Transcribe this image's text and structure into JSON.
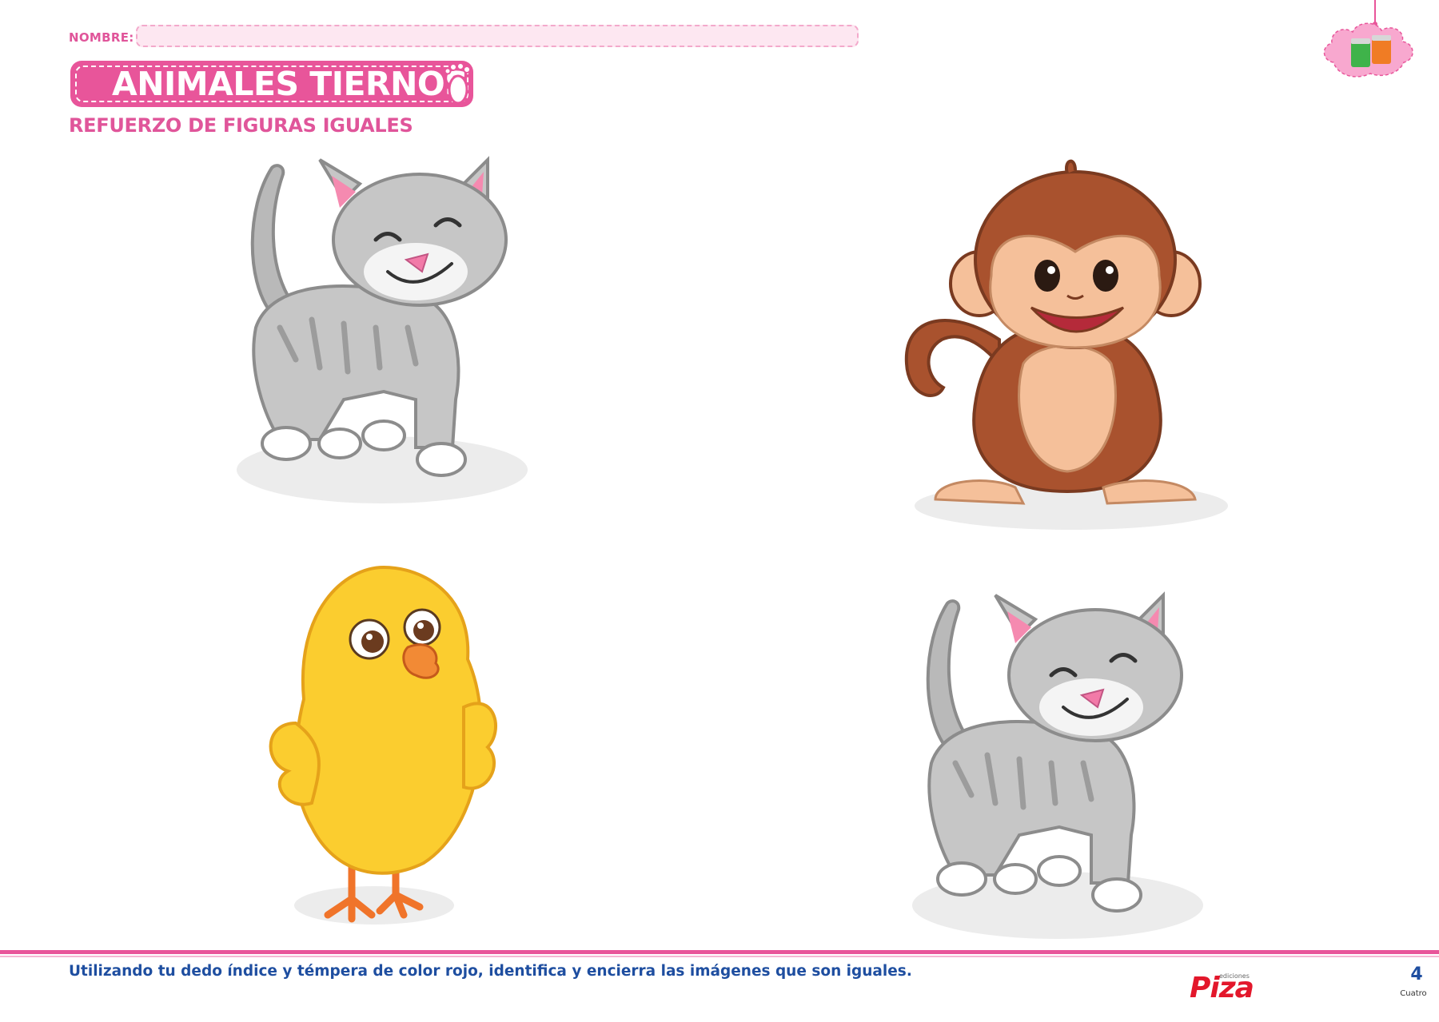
{
  "header": {
    "name_label": "NOMBRE:",
    "title": "ANIMALES TIERNOS",
    "subtitle": "REFUERZO DE FIGURAS IGUALES"
  },
  "figures": [
    {
      "animal": "kitten-icon"
    },
    {
      "animal": "monkey-icon"
    },
    {
      "animal": "chick-icon"
    },
    {
      "animal": "kitten-icon"
    }
  ],
  "footer": {
    "instruction": "Utilizando tu dedo índice y témpera de color rojo, identifica y encierra las imágenes que son iguales.",
    "publisher_small": "ediciones",
    "publisher": "Piza",
    "page_number": "4",
    "page_word": "Cuatro"
  },
  "colors": {
    "pink": "#e8559a",
    "blue": "#1e4ea0",
    "red": "#e3172b"
  }
}
